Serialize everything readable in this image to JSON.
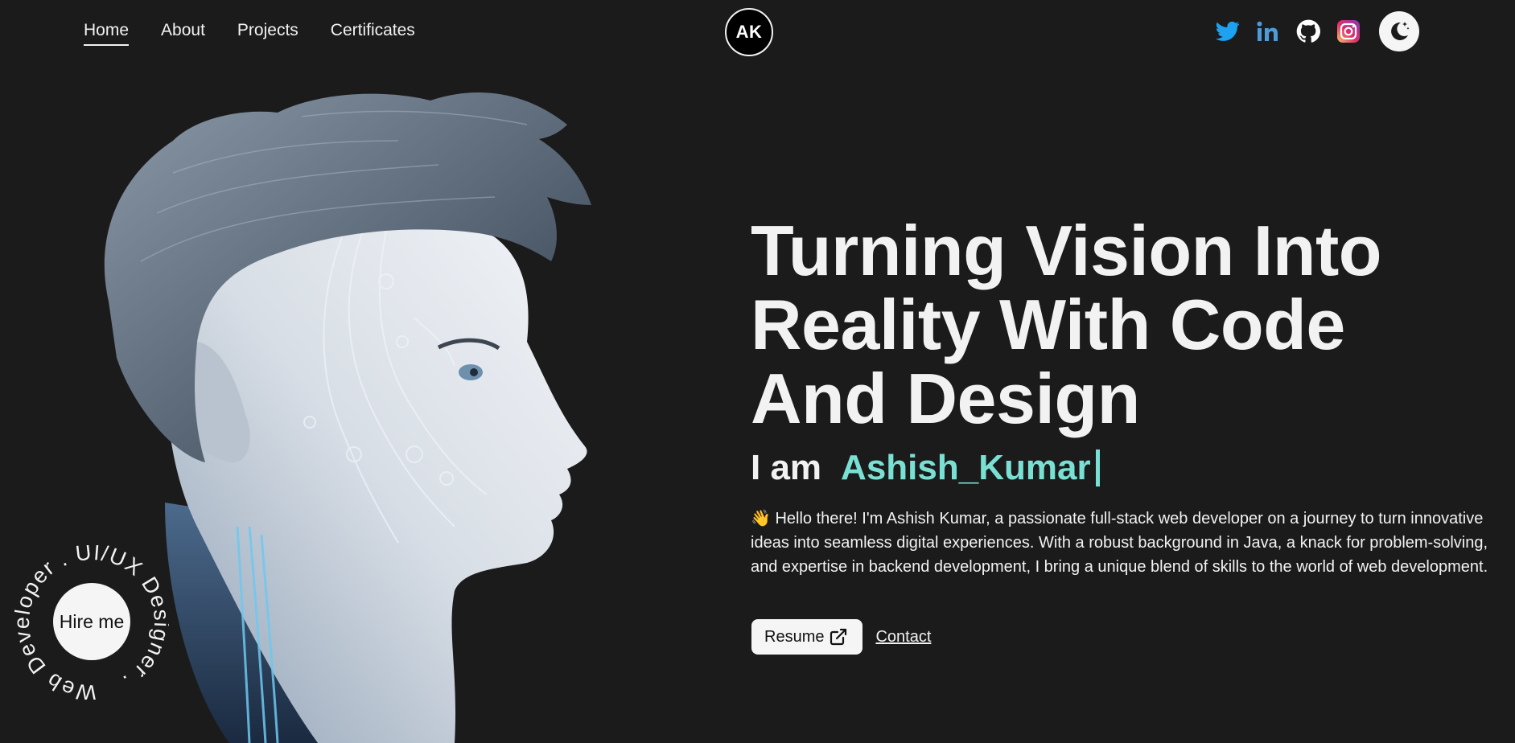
{
  "nav": {
    "items": [
      {
        "label": "Home",
        "active": true
      },
      {
        "label": "About"
      },
      {
        "label": "Projects"
      },
      {
        "label": "Certificates"
      }
    ]
  },
  "logo": {
    "text": "AK"
  },
  "socials": [
    {
      "icon": "twitter-icon",
      "color": "#1da1f2"
    },
    {
      "icon": "linkedin-icon",
      "color": "#0a66c2"
    },
    {
      "icon": "github-icon",
      "color": "#ffffff"
    },
    {
      "icon": "instagram-icon",
      "color": "#e1306c"
    }
  ],
  "theme_toggle": {
    "icon": "moon-icon"
  },
  "hero": {
    "title": "Turning Vision Into Reality With Code And Design",
    "prefix": "I am",
    "name": "Ashish_Kumar",
    "bio": "👋 Hello there! I'm Ashish Kumar, a passionate full-stack web developer on a journey to turn innovative ideas into seamless digital experiences. With a robust background in Java, a knack for problem-solving, and expertise in backend development, I bring a unique blend of skills to the world of web development.",
    "resume_label": "Resume",
    "contact_label": "Contact"
  },
  "badge": {
    "ring_text": "Web Developer . UI/UX Designer .",
    "button_label": "Hire me"
  },
  "colors": {
    "background": "#1b1b1b",
    "accent": "#7ae0d4",
    "text": "#f2f2f2"
  }
}
